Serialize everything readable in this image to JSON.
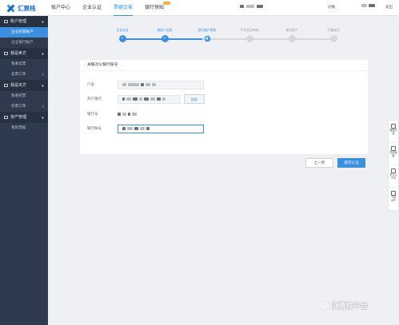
{
  "brand": {
    "name": "汇票栈"
  },
  "nav": {
    "items": [
      {
        "label": "账户中心",
        "active": false
      },
      {
        "label": "企业认证",
        "active": false
      },
      {
        "label": "票据交易",
        "active": true
      },
      {
        "label": "银行快贴",
        "active": false,
        "badge": "new"
      }
    ]
  },
  "header": {
    "switch_label": "切换",
    "logout_label": "退出"
  },
  "sidebar": {
    "groups": [
      {
        "label": "账户管理",
        "items": [
          {
            "label": "企业背景账户",
            "active": true
          },
          {
            "label": "企业银行账户",
            "active": false
          }
        ]
      },
      {
        "label": "我是卖方",
        "items": [
          {
            "label": "我要卖票",
            "active": false
          },
          {
            "label": "卖票订单",
            "count": "0",
            "active": false
          }
        ]
      },
      {
        "label": "我是买方",
        "items": [
          {
            "label": "我要买票",
            "active": false
          },
          {
            "label": "买票订单",
            "count": "0",
            "active": false
          }
        ]
      },
      {
        "label": "资产管理",
        "items": [
          {
            "label": "我的票据",
            "active": false
          }
        ]
      }
    ]
  },
  "steps": [
    {
      "label": "企业认证",
      "state": "done"
    },
    {
      "label": "授权人信息",
      "state": "done"
    },
    {
      "label": "银行账户绑定",
      "state": "current"
    },
    {
      "label": "平台验证审核",
      "state": "todo"
    },
    {
      "label": "激活账户",
      "state": "todo"
    },
    {
      "label": "开通成功",
      "state": "todo"
    }
  ],
  "form": {
    "title": "关联对公银行账号",
    "fields": [
      {
        "label": "户名"
      },
      {
        "label": "开户银行",
        "button": "搜索"
      },
      {
        "label": "银行号"
      },
      {
        "label": "银行账号"
      }
    ]
  },
  "buttons": {
    "prev": "上一步",
    "submit": "提交认证"
  },
  "float_bar": [
    {
      "icon": "customer-service-icon",
      "text": "客服热线"
    },
    {
      "icon": "phone-icon",
      "text": "在线客服"
    },
    {
      "icon": "wechat-icon",
      "text": "关注公众号"
    },
    {
      "icon": "qr-icon",
      "text": "下载APP"
    }
  ],
  "watermark": {
    "text": "汇票栈平台"
  },
  "colors": {
    "accent": "#3b8fde",
    "sidebar": "#2e3a4d",
    "badge": "#f0a028"
  }
}
